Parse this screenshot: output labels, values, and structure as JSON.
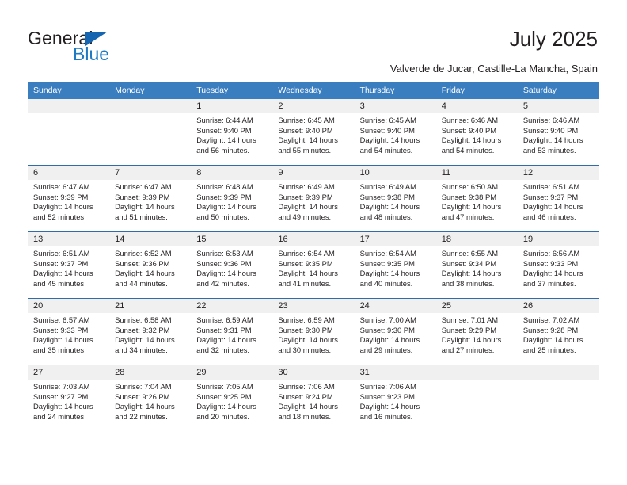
{
  "brand": {
    "name_part1": "General",
    "name_part2": "Blue",
    "triangle_icon": "triangle-icon",
    "accent_color": "#1f7ac4"
  },
  "header": {
    "title": "July 2025",
    "subtitle": "Valverde de Jucar, Castille-La Mancha, Spain"
  },
  "calendar": {
    "header_color": "#3b7ec0",
    "daynum_bg": "#f0f0f0",
    "weekdays": [
      "Sunday",
      "Monday",
      "Tuesday",
      "Wednesday",
      "Thursday",
      "Friday",
      "Saturday"
    ],
    "weeks": [
      {
        "days": [
          {
            "num": "",
            "sunrise": "",
            "sunset": "",
            "daylight1": "",
            "daylight2": ""
          },
          {
            "num": "",
            "sunrise": "",
            "sunset": "",
            "daylight1": "",
            "daylight2": ""
          },
          {
            "num": "1",
            "sunrise": "Sunrise: 6:44 AM",
            "sunset": "Sunset: 9:40 PM",
            "daylight1": "Daylight: 14 hours",
            "daylight2": "and 56 minutes."
          },
          {
            "num": "2",
            "sunrise": "Sunrise: 6:45 AM",
            "sunset": "Sunset: 9:40 PM",
            "daylight1": "Daylight: 14 hours",
            "daylight2": "and 55 minutes."
          },
          {
            "num": "3",
            "sunrise": "Sunrise: 6:45 AM",
            "sunset": "Sunset: 9:40 PM",
            "daylight1": "Daylight: 14 hours",
            "daylight2": "and 54 minutes."
          },
          {
            "num": "4",
            "sunrise": "Sunrise: 6:46 AM",
            "sunset": "Sunset: 9:40 PM",
            "daylight1": "Daylight: 14 hours",
            "daylight2": "and 54 minutes."
          },
          {
            "num": "5",
            "sunrise": "Sunrise: 6:46 AM",
            "sunset": "Sunset: 9:40 PM",
            "daylight1": "Daylight: 14 hours",
            "daylight2": "and 53 minutes."
          }
        ]
      },
      {
        "days": [
          {
            "num": "6",
            "sunrise": "Sunrise: 6:47 AM",
            "sunset": "Sunset: 9:39 PM",
            "daylight1": "Daylight: 14 hours",
            "daylight2": "and 52 minutes."
          },
          {
            "num": "7",
            "sunrise": "Sunrise: 6:47 AM",
            "sunset": "Sunset: 9:39 PM",
            "daylight1": "Daylight: 14 hours",
            "daylight2": "and 51 minutes."
          },
          {
            "num": "8",
            "sunrise": "Sunrise: 6:48 AM",
            "sunset": "Sunset: 9:39 PM",
            "daylight1": "Daylight: 14 hours",
            "daylight2": "and 50 minutes."
          },
          {
            "num": "9",
            "sunrise": "Sunrise: 6:49 AM",
            "sunset": "Sunset: 9:39 PM",
            "daylight1": "Daylight: 14 hours",
            "daylight2": "and 49 minutes."
          },
          {
            "num": "10",
            "sunrise": "Sunrise: 6:49 AM",
            "sunset": "Sunset: 9:38 PM",
            "daylight1": "Daylight: 14 hours",
            "daylight2": "and 48 minutes."
          },
          {
            "num": "11",
            "sunrise": "Sunrise: 6:50 AM",
            "sunset": "Sunset: 9:38 PM",
            "daylight1": "Daylight: 14 hours",
            "daylight2": "and 47 minutes."
          },
          {
            "num": "12",
            "sunrise": "Sunrise: 6:51 AM",
            "sunset": "Sunset: 9:37 PM",
            "daylight1": "Daylight: 14 hours",
            "daylight2": "and 46 minutes."
          }
        ]
      },
      {
        "days": [
          {
            "num": "13",
            "sunrise": "Sunrise: 6:51 AM",
            "sunset": "Sunset: 9:37 PM",
            "daylight1": "Daylight: 14 hours",
            "daylight2": "and 45 minutes."
          },
          {
            "num": "14",
            "sunrise": "Sunrise: 6:52 AM",
            "sunset": "Sunset: 9:36 PM",
            "daylight1": "Daylight: 14 hours",
            "daylight2": "and 44 minutes."
          },
          {
            "num": "15",
            "sunrise": "Sunrise: 6:53 AM",
            "sunset": "Sunset: 9:36 PM",
            "daylight1": "Daylight: 14 hours",
            "daylight2": "and 42 minutes."
          },
          {
            "num": "16",
            "sunrise": "Sunrise: 6:54 AM",
            "sunset": "Sunset: 9:35 PM",
            "daylight1": "Daylight: 14 hours",
            "daylight2": "and 41 minutes."
          },
          {
            "num": "17",
            "sunrise": "Sunrise: 6:54 AM",
            "sunset": "Sunset: 9:35 PM",
            "daylight1": "Daylight: 14 hours",
            "daylight2": "and 40 minutes."
          },
          {
            "num": "18",
            "sunrise": "Sunrise: 6:55 AM",
            "sunset": "Sunset: 9:34 PM",
            "daylight1": "Daylight: 14 hours",
            "daylight2": "and 38 minutes."
          },
          {
            "num": "19",
            "sunrise": "Sunrise: 6:56 AM",
            "sunset": "Sunset: 9:33 PM",
            "daylight1": "Daylight: 14 hours",
            "daylight2": "and 37 minutes."
          }
        ]
      },
      {
        "days": [
          {
            "num": "20",
            "sunrise": "Sunrise: 6:57 AM",
            "sunset": "Sunset: 9:33 PM",
            "daylight1": "Daylight: 14 hours",
            "daylight2": "and 35 minutes."
          },
          {
            "num": "21",
            "sunrise": "Sunrise: 6:58 AM",
            "sunset": "Sunset: 9:32 PM",
            "daylight1": "Daylight: 14 hours",
            "daylight2": "and 34 minutes."
          },
          {
            "num": "22",
            "sunrise": "Sunrise: 6:59 AM",
            "sunset": "Sunset: 9:31 PM",
            "daylight1": "Daylight: 14 hours",
            "daylight2": "and 32 minutes."
          },
          {
            "num": "23",
            "sunrise": "Sunrise: 6:59 AM",
            "sunset": "Sunset: 9:30 PM",
            "daylight1": "Daylight: 14 hours",
            "daylight2": "and 30 minutes."
          },
          {
            "num": "24",
            "sunrise": "Sunrise: 7:00 AM",
            "sunset": "Sunset: 9:30 PM",
            "daylight1": "Daylight: 14 hours",
            "daylight2": "and 29 minutes."
          },
          {
            "num": "25",
            "sunrise": "Sunrise: 7:01 AM",
            "sunset": "Sunset: 9:29 PM",
            "daylight1": "Daylight: 14 hours",
            "daylight2": "and 27 minutes."
          },
          {
            "num": "26",
            "sunrise": "Sunrise: 7:02 AM",
            "sunset": "Sunset: 9:28 PM",
            "daylight1": "Daylight: 14 hours",
            "daylight2": "and 25 minutes."
          }
        ]
      },
      {
        "days": [
          {
            "num": "27",
            "sunrise": "Sunrise: 7:03 AM",
            "sunset": "Sunset: 9:27 PM",
            "daylight1": "Daylight: 14 hours",
            "daylight2": "and 24 minutes."
          },
          {
            "num": "28",
            "sunrise": "Sunrise: 7:04 AM",
            "sunset": "Sunset: 9:26 PM",
            "daylight1": "Daylight: 14 hours",
            "daylight2": "and 22 minutes."
          },
          {
            "num": "29",
            "sunrise": "Sunrise: 7:05 AM",
            "sunset": "Sunset: 9:25 PM",
            "daylight1": "Daylight: 14 hours",
            "daylight2": "and 20 minutes."
          },
          {
            "num": "30",
            "sunrise": "Sunrise: 7:06 AM",
            "sunset": "Sunset: 9:24 PM",
            "daylight1": "Daylight: 14 hours",
            "daylight2": "and 18 minutes."
          },
          {
            "num": "31",
            "sunrise": "Sunrise: 7:06 AM",
            "sunset": "Sunset: 9:23 PM",
            "daylight1": "Daylight: 14 hours",
            "daylight2": "and 16 minutes."
          },
          {
            "num": "",
            "sunrise": "",
            "sunset": "",
            "daylight1": "",
            "daylight2": ""
          },
          {
            "num": "",
            "sunrise": "",
            "sunset": "",
            "daylight1": "",
            "daylight2": ""
          }
        ]
      }
    ]
  }
}
